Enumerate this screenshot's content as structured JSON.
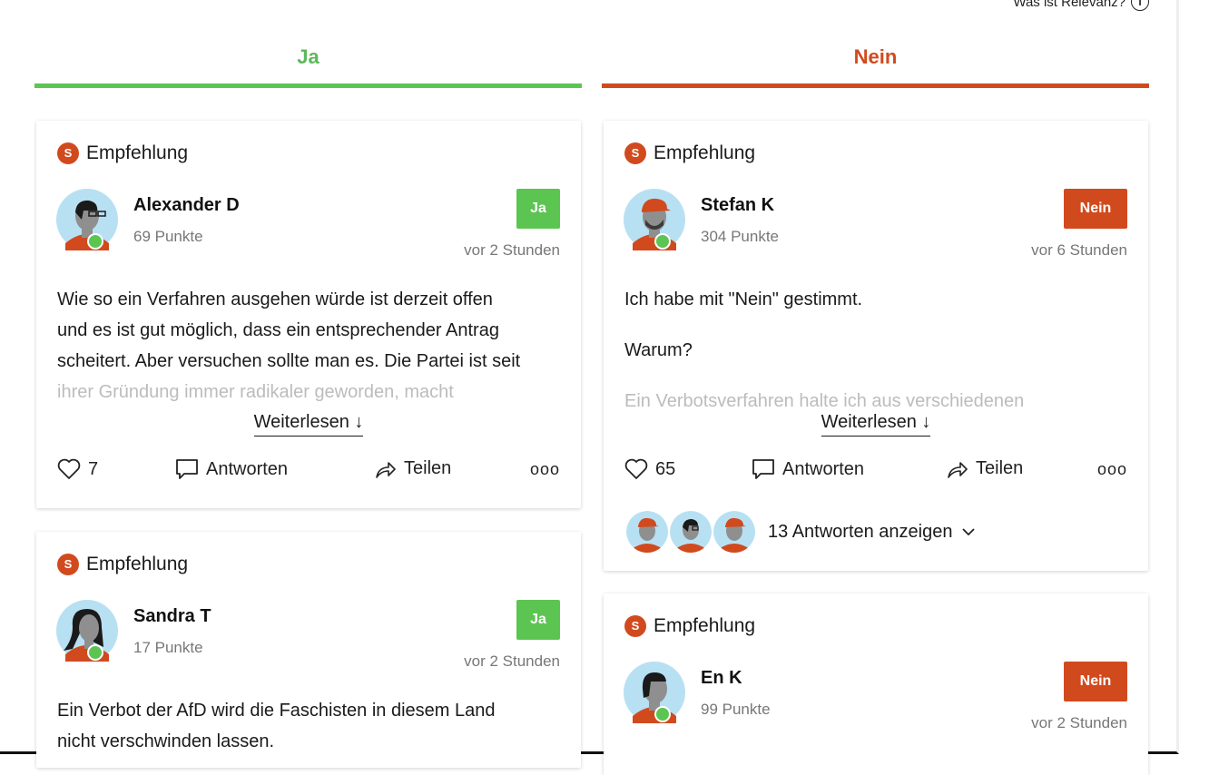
{
  "relevance": {
    "label": "Was ist Relevanz?",
    "info_glyph": "i"
  },
  "columns": {
    "yes": "Ja",
    "no": "Nein"
  },
  "colors": {
    "yes": "#5cc552",
    "no": "#d14a1e"
  },
  "badge_glyph": "S",
  "read_more": "Weiterlesen ↓",
  "reply_label": "Antworten",
  "share_label": "Teilen",
  "more_glyph": "ooo",
  "cards": {
    "c1": {
      "tag": "Empfehlung",
      "name": "Alexander D",
      "points": "69 Punkte",
      "vote": "Ja",
      "time": "vor 2 Stunden",
      "lines": [
        "Wie so ein Verfahren ausgehen würde ist derzeit offen",
        "und es ist gut möglich, dass ein entsprechender Antrag",
        "scheitert. Aber versuchen sollte man es. Die Partei ist seit"
      ],
      "faded": "ihrer Gründung immer radikaler geworden, macht",
      "likes": "7"
    },
    "c2": {
      "tag": "Empfehlung",
      "name": "Stefan K",
      "points": "304 Punkte",
      "vote": "Nein",
      "time": "vor 6 Stunden",
      "p1": "Ich habe mit \"Nein\" gestimmt.",
      "p2": "Warum?",
      "faded": "Ein Verbotsverfahren halte ich aus verschiedenen",
      "likes": "65",
      "replies": "13 Antworten anzeigen"
    },
    "c3": {
      "tag": "Empfehlung",
      "name": "Sandra T",
      "points": "17 Punkte",
      "vote": "Ja",
      "time": "vor 2 Stunden",
      "lines": [
        "Ein Verbot der AfD wird die Faschisten in diesem Land",
        "nicht verschwinden lassen."
      ]
    },
    "c4": {
      "tag": "Empfehlung",
      "name": "En K",
      "points": "99 Punkte",
      "vote": "Nein",
      "time": "vor 2 Stunden"
    }
  }
}
